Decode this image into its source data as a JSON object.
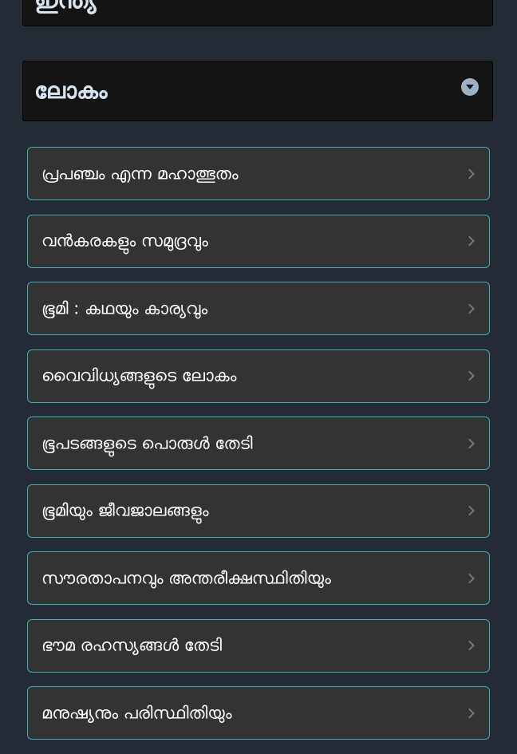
{
  "previous_section": {
    "title": "ഇന്ത്യ"
  },
  "current_section": {
    "title": "ലോകം",
    "toggle_icon": "chevron-down-circle-icon"
  },
  "chapters": [
    {
      "label": "പ്രപഞ്ചം എന്ന മഹാത്ഭുതം"
    },
    {
      "label": "വൻകരകളും സമുദ്രവും"
    },
    {
      "label": "ഭൂമി : കഥയും കാര്യവും"
    },
    {
      "label": "വൈവിധ്യങ്ങളുടെ ലോകം"
    },
    {
      "label": "ഭൂപടങ്ങളുടെ പൊരുൾ തേടി"
    },
    {
      "label": "ഭൂമിയും ജീവജാലങ്ങളും"
    },
    {
      "label": "സൗരതാപനവും അന്തരീക്ഷസ്ഥിതിയും"
    },
    {
      "label": "ഭൗമ രഹസ്യങ്ങൾ തേടി"
    },
    {
      "label": "മനുഷ്യനും പരിസ്ഥിതിയും"
    }
  ],
  "colors": {
    "background": "#252b34",
    "header_background": "#141414",
    "item_background": "#333333",
    "item_border": "#3ab0b5",
    "header_text": "#d7e4f0"
  }
}
